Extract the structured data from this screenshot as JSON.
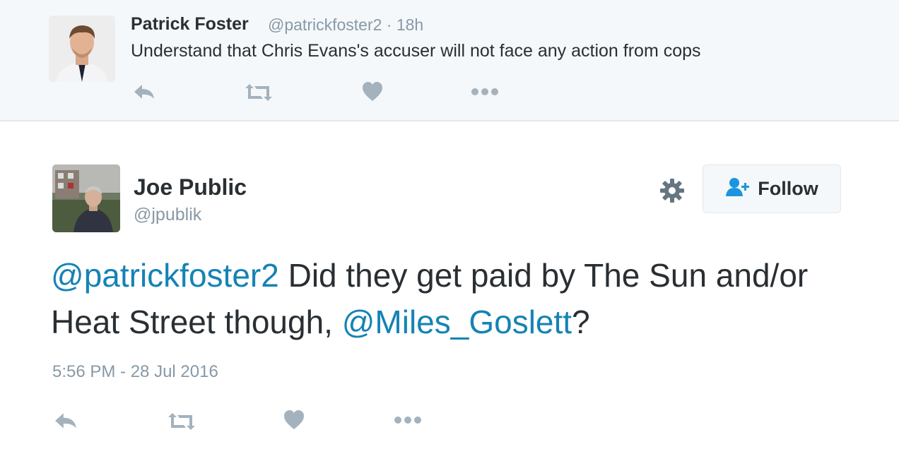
{
  "parent_tweet": {
    "author_name": "Patrick Foster",
    "author_handle": "@patrickfoster2",
    "time_ago": "· 18h",
    "text": "Understand that Chris Evans's accuser will not face any action from cops",
    "actions": [
      "reply-icon",
      "retweet-icon",
      "like-icon",
      "more-icon"
    ]
  },
  "main_tweet": {
    "author_name": "Joe Public",
    "author_handle": "@jpublik",
    "follow_label": "Follow",
    "text_parts": {
      "mention1": "@patrickfoster2",
      "body1": " Did they get paid by The Sun and/or Heat Street though, ",
      "mention2": "@Miles_Goslett",
      "body2": "?"
    },
    "timestamp": "5:56 PM - 28 Jul 2016",
    "actions": [
      "reply-icon",
      "retweet-icon",
      "like-icon",
      "more-icon"
    ]
  },
  "colors": {
    "link": "#1583b4",
    "muted": "#8899a6",
    "text": "#292f33",
    "icon": "#a4b2bd",
    "parent_bg": "#f5f8fa"
  }
}
